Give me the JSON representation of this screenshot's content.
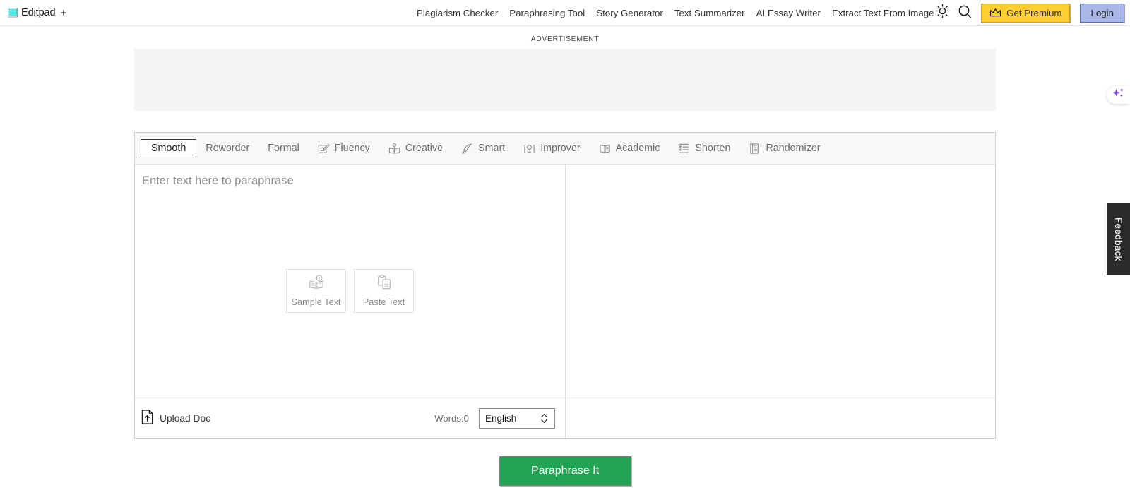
{
  "header": {
    "brand_name": "Editpad",
    "brand_plus": "+",
    "brand_icon": "notepad-icon",
    "nav_links": [
      {
        "label": "Plagiarism Checker"
      },
      {
        "label": "Paraphrasing Tool"
      },
      {
        "label": "Story Generator"
      },
      {
        "label": "Text Summarizer"
      },
      {
        "label": "AI Essay Writer"
      },
      {
        "label": "Extract Text From Image"
      }
    ],
    "theme_toggle_icon": "sun-icon",
    "search_icon": "search-icon",
    "premium_button": {
      "label": "Get Premium",
      "icon": "crown-icon",
      "color": "#FFCE32"
    },
    "login_button": {
      "label": "Login",
      "color": "#A8B6E8"
    }
  },
  "advertisement": {
    "label": "ADVERTISEMENT"
  },
  "tool": {
    "tabs": [
      {
        "label": "Smooth",
        "icon": null,
        "active": true
      },
      {
        "label": "Reworder",
        "icon": null,
        "active": false
      },
      {
        "label": "Formal",
        "icon": null,
        "active": false
      },
      {
        "label": "Fluency",
        "icon": "pencil-note-icon",
        "active": false
      },
      {
        "label": "Creative",
        "icon": "open-book-bulb-icon",
        "active": false
      },
      {
        "label": "Smart",
        "icon": "quill-pen-icon",
        "active": false
      },
      {
        "label": "Improver",
        "icon": "bulb-book-icon",
        "active": false
      },
      {
        "label": "Academic",
        "icon": "book-icon",
        "active": false
      },
      {
        "label": "Shorten",
        "icon": "list-lines-icon",
        "active": false
      },
      {
        "label": "Randomizer",
        "icon": "pages-icon",
        "active": false
      }
    ],
    "editor": {
      "placeholder": "Enter text here to paraphrase",
      "value": "",
      "quick_actions": [
        {
          "label": "Sample Text",
          "icon": "sample-text-icon"
        },
        {
          "label": "Paste Text",
          "icon": "clipboard-icon"
        }
      ]
    },
    "output": {
      "value": ""
    },
    "footer": {
      "upload_label": "Upload Doc",
      "upload_icon": "upload-file-icon",
      "word_count": "Words:0",
      "language_selected": "English"
    },
    "submit_button": {
      "label": "Paraphrase It",
      "color": "#22a353"
    }
  },
  "widgets": {
    "sparkle_icon": "sparkle-icon",
    "sparkle_color": "#7c3aed",
    "feedback_label": "Feedback"
  }
}
